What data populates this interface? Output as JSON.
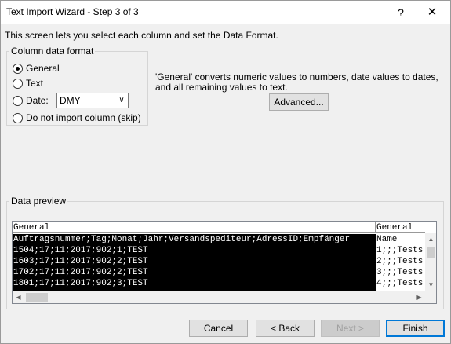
{
  "window": {
    "title": "Text Import Wizard - Step 3 of 3",
    "help_glyph": "?",
    "close_glyph": "✕"
  },
  "intro": "This screen lets you select each column and set the Data Format.",
  "column_format": {
    "group_label": "Column data format",
    "options": [
      {
        "label": "General",
        "selected": true
      },
      {
        "label": "Text",
        "selected": false
      },
      {
        "label": "Date:",
        "selected": false
      },
      {
        "label": "Do not import column (skip)",
        "selected": false
      }
    ],
    "date_value": "DMY"
  },
  "description": "'General' converts numeric values to numbers, date values to dates, and all remaining values to text.",
  "advanced_label": "Advanced...",
  "preview": {
    "group_label": "Data preview",
    "col1_header": "General",
    "col2_header": "General",
    "col1_rows": [
      "Auftragsnummer;Tag;Monat;Jahr;Versandspediteur;AdressID;Empfänger",
      "1504;17;11;2017;902;1;TEST",
      "1603;17;11;2017;902;2;TEST",
      "1702;17;11;2017;902;2;TEST",
      "1801;17;11;2017;902;3;TEST"
    ],
    "col2_rows": [
      "Name",
      "1;;;Tests",
      "2;;;Tests",
      "3;;;Tests",
      "4;;;Tests"
    ]
  },
  "buttons": {
    "cancel": "Cancel",
    "back": "< Back",
    "next": "Next >",
    "finish": "Finish"
  }
}
